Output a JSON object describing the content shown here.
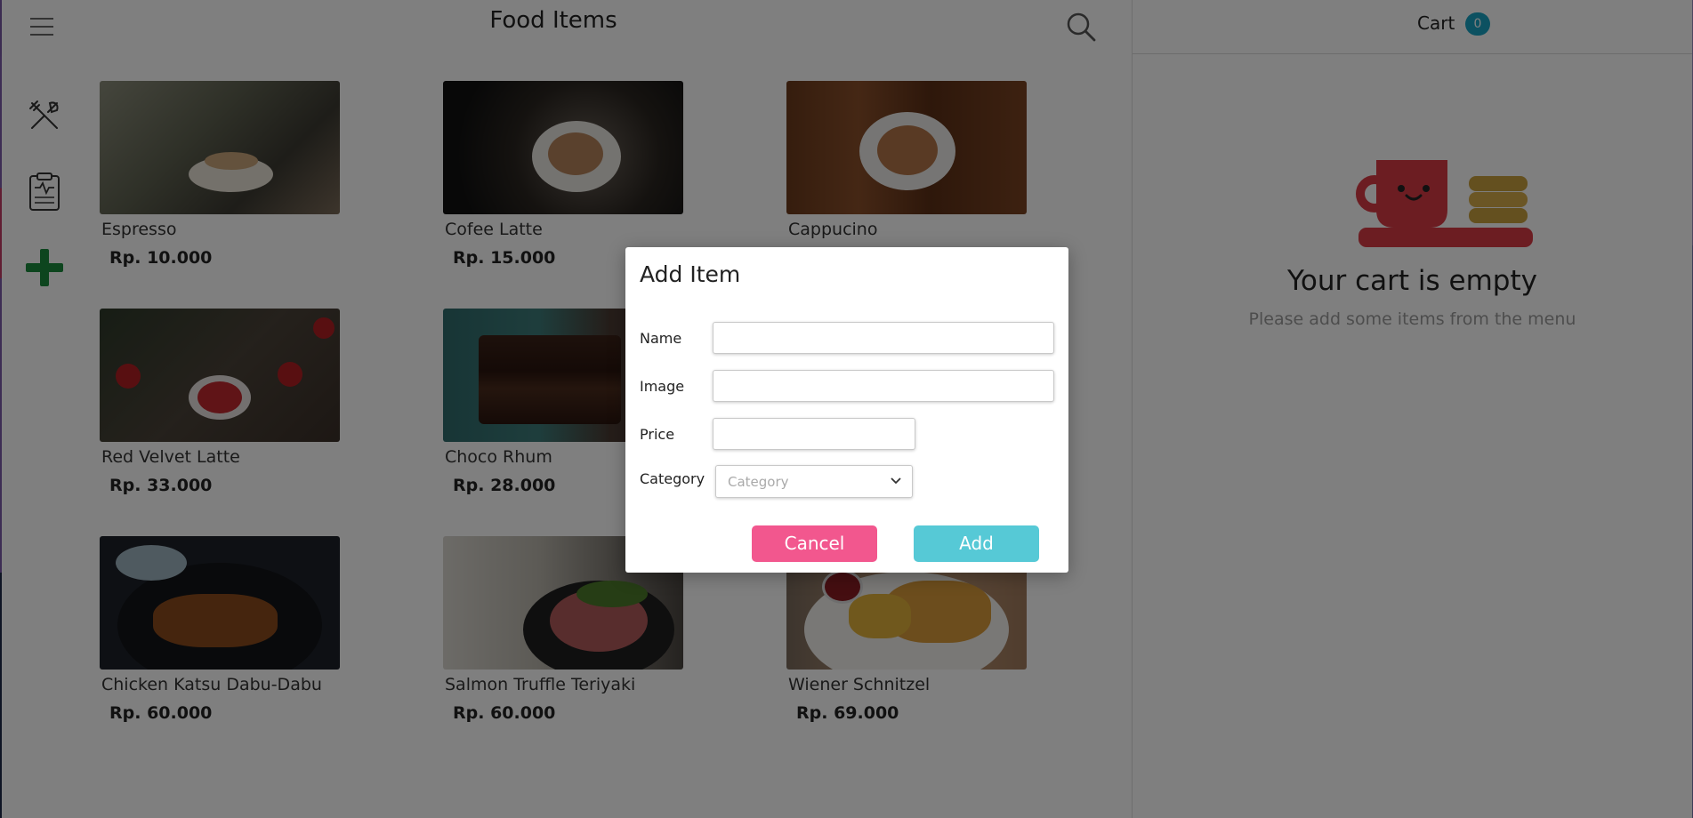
{
  "header": {
    "title": "Food Items"
  },
  "sidebar": {
    "items": [
      {
        "name": "food",
        "icon": "fork-knife-icon"
      },
      {
        "name": "report",
        "icon": "clipboard-icon"
      },
      {
        "name": "add",
        "icon": "plus-icon",
        "color": "#1a8a3c"
      }
    ]
  },
  "menu": {
    "items": [
      {
        "name": "Espresso",
        "price": "Rp. 10.000"
      },
      {
        "name": "Cofee Latte",
        "price": "Rp. 15.000"
      },
      {
        "name": "Cappucino",
        "price": ""
      },
      {
        "name": "Red Velvet Latte",
        "price": "Rp. 33.000"
      },
      {
        "name": "Choco Rhum",
        "price": "Rp. 28.000"
      },
      {
        "name": "Chicken Katsu Dabu-Dabu",
        "price": "Rp. 60.000"
      },
      {
        "name": "Salmon Truffle Teriyaki",
        "price": "Rp. 60.000"
      },
      {
        "name": "Wiener Schnitzel",
        "price": "Rp. 69.000"
      }
    ]
  },
  "cart": {
    "title": "Cart",
    "count": "0",
    "empty_title": "Your cart is empty",
    "empty_subtitle": "Please add some items from the menu"
  },
  "modal": {
    "title": "Add Item",
    "fields": {
      "name": {
        "label": "Name",
        "value": ""
      },
      "image": {
        "label": "Image",
        "value": ""
      },
      "price": {
        "label": "Price",
        "value": ""
      },
      "category": {
        "label": "Category",
        "placeholder": "Category"
      }
    },
    "cancel_label": "Cancel",
    "add_label": "Add"
  },
  "colors": {
    "cancel": "#f2578e",
    "add": "#56c9d6",
    "badge": "#19a3c3"
  }
}
